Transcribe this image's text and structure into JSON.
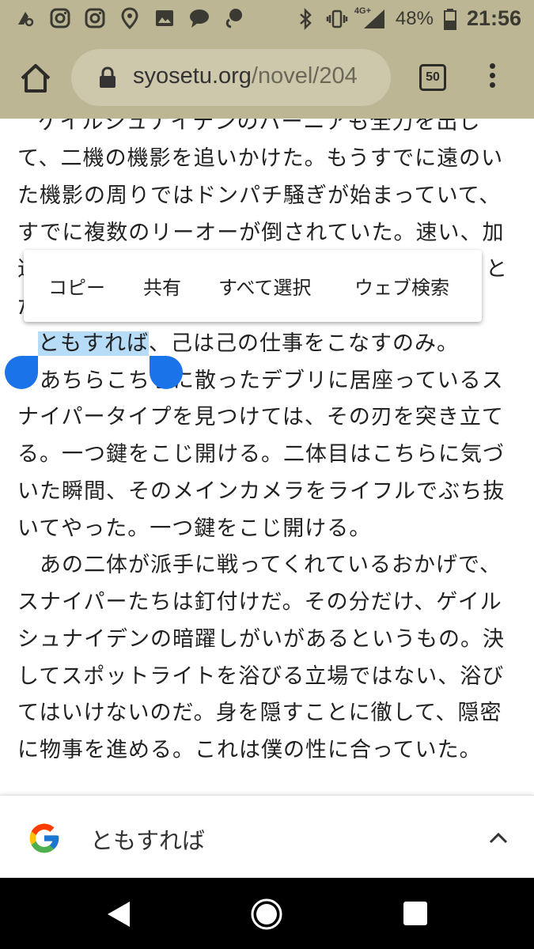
{
  "status_bar": {
    "network": "4G+",
    "battery": "48%",
    "time": "21:56",
    "icons": [
      "notification-icon",
      "instagram-icon",
      "instagram-icon",
      "location-icon",
      "image-icon",
      "chat-icon",
      "message-icon",
      "bluetooth-icon",
      "vibrate-icon",
      "signal-icon",
      "battery-icon"
    ]
  },
  "browser": {
    "url_host": "syosetu.org",
    "url_path": "/novel/204",
    "tab_count": "50"
  },
  "content": {
    "lines": [
      "ゲイルシュナイデンのバーニアも全力を出し",
      "て、二機の機影を追いかけた。もうすでに遠のい",
      "た機影の周りではドンパチ騒ぎが始まっていて、",
      "すでに複数のリーオーが倒されていた。速い、加",
      "速",
      "と",
      "だ",
      "、己は己の仕事をこなすのみ。",
      "　あちらこちらに散ったデブリに居座っているス",
      "ナイパータイプを見つけては、その刃を突き立て",
      "る。一つ鍵をこじ開ける。二体目はこちらに気づ",
      "いた瞬間、そのメインカメラをライフルでぶち抜",
      "いてやった。一つ鍵をこじ開ける。",
      "　あの二体が派手に戦ってくれているおかげで、",
      "スナイパーたちは釘付けだ。その分だけ、ゲイル",
      "シュナイデンの暗躍しがいがあるというもの。決",
      "してスポットライトを浴びる立場ではない、浴び",
      "てはいけないのだ。身を隠すことに徹して、隠密",
      "に物事を進める。これは僕の性に合っていた。"
    ],
    "selected_text": "ともすれば"
  },
  "context_menu": {
    "copy": "コピー",
    "share": "共有",
    "select_all": "すべて選択",
    "web_search": "ウェブ検索"
  },
  "search_bar": {
    "query": "ともすれば"
  },
  "colors": {
    "toolbar": "#bdb695",
    "url_box": "#cdc7ab",
    "selection": "#b6dcf7",
    "handle": "#1a73e8"
  }
}
